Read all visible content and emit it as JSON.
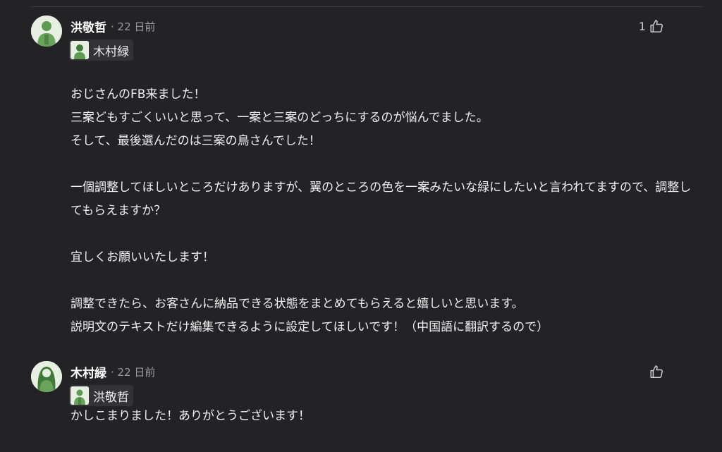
{
  "comments": [
    {
      "author": "洪敬哲",
      "meta": "· 22 日前",
      "like_count": "1",
      "mention": "木村緑",
      "paragraphs": [
        [
          "おじさんのFB来ました！",
          "三案どもすごくいいと思って、一案と三案のどっちにするのが悩んでました。",
          "そして、最後選んだのは三案の鳥さんでした！"
        ],
        [
          "一個調整してほしいところだけありますが、翼のところの色を一案みたいな緑にしたいと言われてますので、調整してもらえますか？"
        ],
        [
          "宜しくお願いいたします！"
        ],
        [
          "調整できたら、お客さんに納品できる状態をまとめてもらえると嬉しいと思います。",
          "説明文のテキストだけ編集できるように設定してほしいです！（中国語に翻訳するので）"
        ]
      ]
    },
    {
      "author": "木村緑",
      "meta": "· 22 日前",
      "like_count": "",
      "mention": "洪敬哲",
      "paragraphs": [
        [
          "かしこまりました！ありがとうございます！"
        ]
      ]
    }
  ],
  "icons": {
    "like": "thumbs-up-icon",
    "avatar": "user-avatar"
  },
  "colors": {
    "background": "#232325",
    "text": "#f0f0f0",
    "muted": "#9a9a9e",
    "avatar_green": "#5f9a52"
  }
}
